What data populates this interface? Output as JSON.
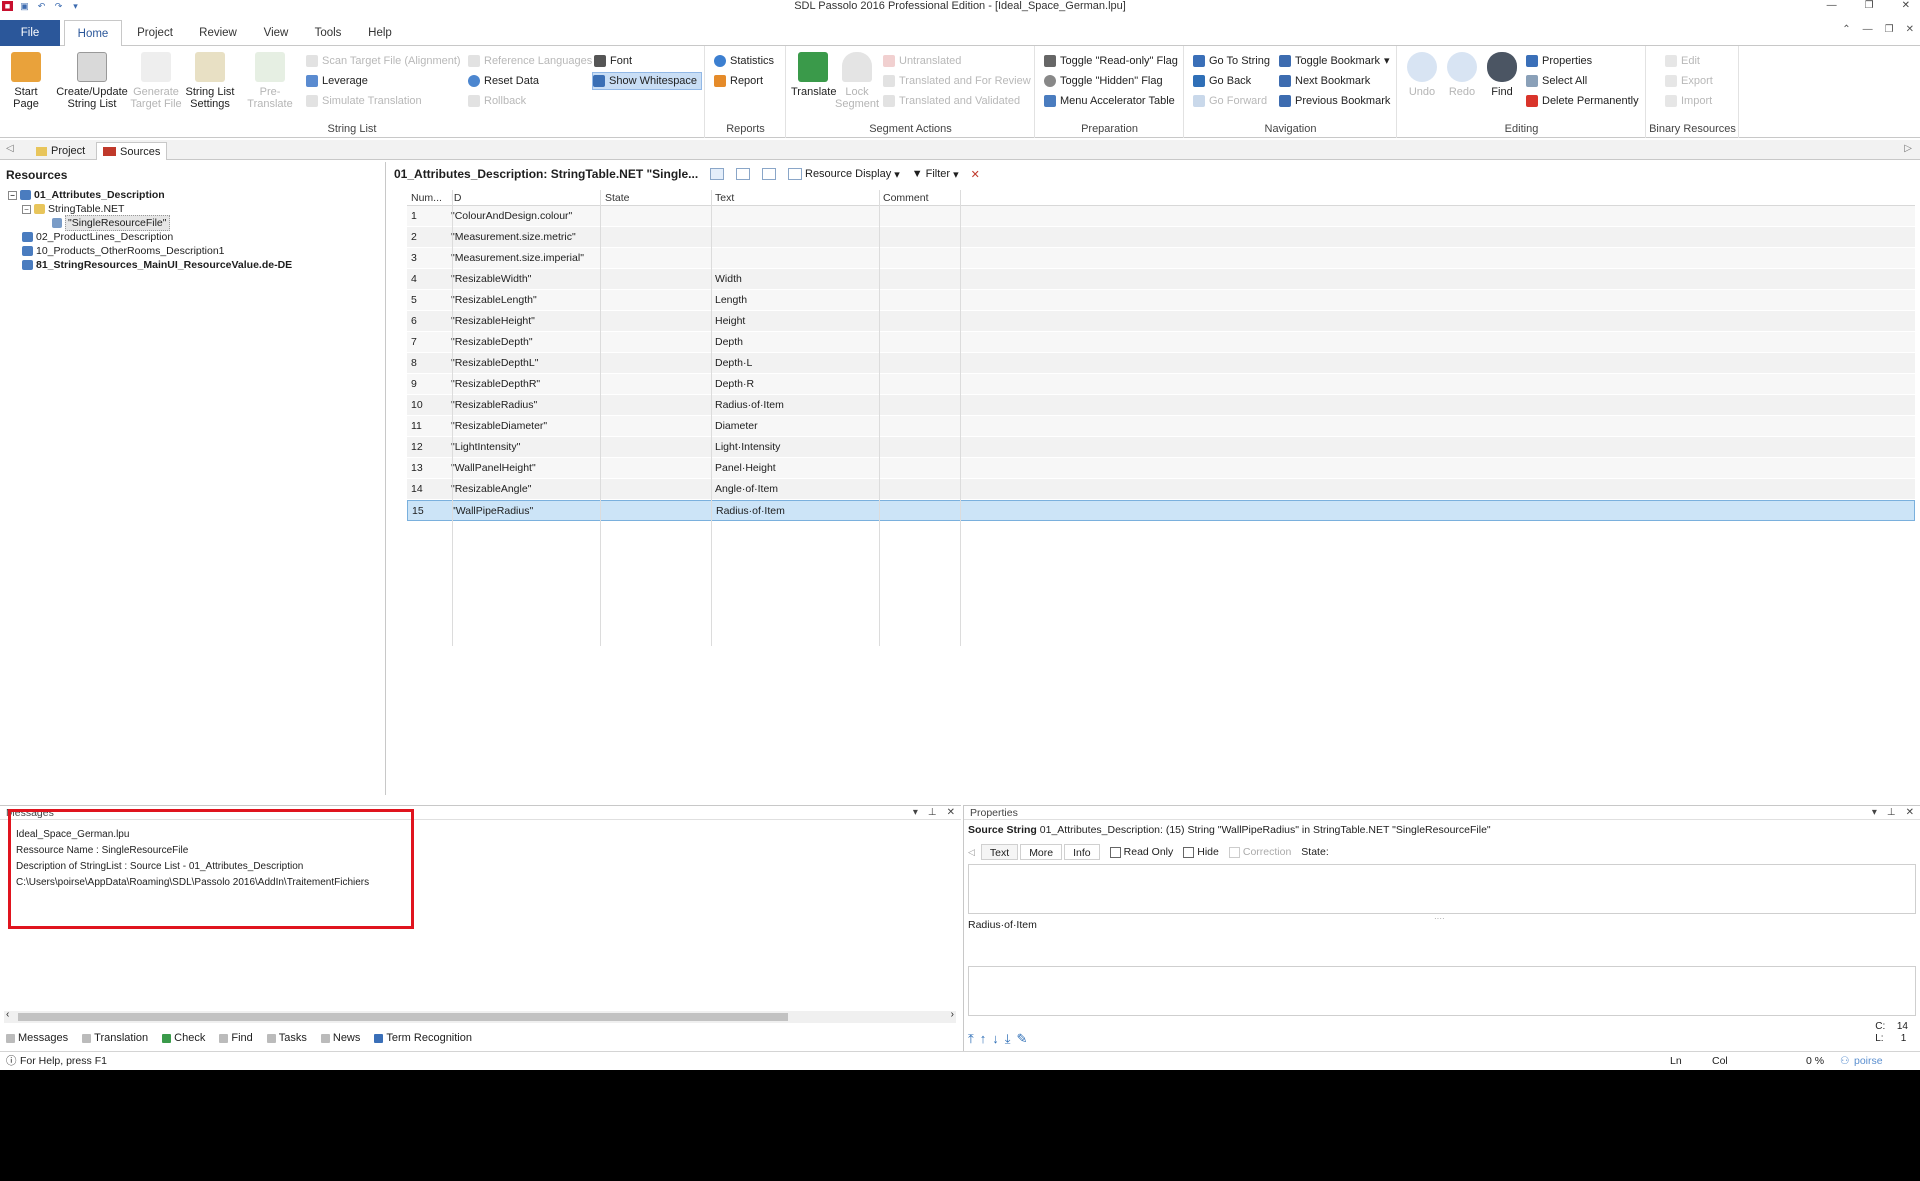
{
  "window": {
    "title": "SDL Passolo 2016 Professional Edition - [Ideal_Space_German.lpu]"
  },
  "menu": {
    "file": "File",
    "tabs": [
      "Home",
      "Project",
      "Review",
      "View",
      "Tools",
      "Help"
    ]
  },
  "ribbon": {
    "string_list": {
      "label": "String List",
      "start_page": "Start Page",
      "create_update": "Create/Update String List",
      "generate_target": "Generate Target File",
      "string_list_settings": "String List Settings",
      "pre_translate": "Pre-Translate",
      "scan_target": "Scan Target File (Alignment)",
      "leverage": "Leverage",
      "simulate": "Simulate Translation",
      "reference_languages": "Reference Languages",
      "reset_data": "Reset Data",
      "rollback": "Rollback",
      "font": "Font",
      "show_whitespace": "Show Whitespace"
    },
    "reports": {
      "label": "Reports",
      "statistics": "Statistics",
      "report": "Report"
    },
    "segment_actions": {
      "label": "Segment Actions",
      "translate": "Translate",
      "lock_segment": "Lock Segment",
      "untranslated": "Untranslated",
      "translated_review": "Translated and For Review",
      "translated_validated": "Translated and Validated"
    },
    "preparation": {
      "label": "Preparation",
      "toggle_readonly": "Toggle \"Read-only\" Flag",
      "toggle_hidden": "Toggle \"Hidden\" Flag",
      "menu_accel": "Menu Accelerator Table"
    },
    "navigation": {
      "label": "Navigation",
      "go_to_string": "Go To String",
      "go_back": "Go Back",
      "go_forward": "Go Forward",
      "toggle_bookmark": "Toggle Bookmark",
      "next_bookmark": "Next Bookmark",
      "previous_bookmark": "Previous Bookmark"
    },
    "editing": {
      "label": "Editing",
      "undo": "Undo",
      "redo": "Redo",
      "find": "Find",
      "properties": "Properties",
      "select_all": "Select All",
      "delete_permanently": "Delete Permanently"
    },
    "binary": {
      "label": "Binary Resources",
      "edit": "Edit",
      "export": "Export",
      "import": "Import"
    }
  },
  "doc_tabs": {
    "project": "Project",
    "sources": "Sources"
  },
  "resources": {
    "header": "Resources",
    "nodes": [
      "01_Attributes_Description",
      "StringTable.NET",
      "\"SingleResourceFile\"",
      "02_ProductLines_Description",
      "10_Products_OtherRooms_Description1",
      "81_StringResources_MainUI_ResourceValue.de-DE"
    ]
  },
  "grid": {
    "title": "01_Attributes_Description: StringTable.NET \"Single...",
    "resource_display": "Resource Display",
    "filter": "Filter",
    "columns": [
      "Num...",
      "ID",
      "State",
      "Text",
      "Comment"
    ],
    "rows": [
      {
        "num": "1",
        "id": "\"ColourAndDesign.colour\"",
        "text": ""
      },
      {
        "num": "2",
        "id": "\"Measurement.size.metric\"",
        "text": ""
      },
      {
        "num": "3",
        "id": "\"Measurement.size.imperial\"",
        "text": ""
      },
      {
        "num": "4",
        "id": "\"ResizableWidth\"",
        "text": "Width"
      },
      {
        "num": "5",
        "id": "\"ResizableLength\"",
        "text": "Length"
      },
      {
        "num": "6",
        "id": "\"ResizableHeight\"",
        "text": "Height"
      },
      {
        "num": "7",
        "id": "\"ResizableDepth\"",
        "text": "Depth"
      },
      {
        "num": "8",
        "id": "\"ResizableDepthL\"",
        "text": "Depth·L"
      },
      {
        "num": "9",
        "id": "\"ResizableDepthR\"",
        "text": "Depth·R"
      },
      {
        "num": "10",
        "id": "\"ResizableRadius\"",
        "text": "Radius·of·Item"
      },
      {
        "num": "11",
        "id": "\"ResizableDiameter\"",
        "text": "Diameter"
      },
      {
        "num": "12",
        "id": "\"LightIntensity\"",
        "text": "Light·Intensity"
      },
      {
        "num": "13",
        "id": "\"WallPanelHeight\"",
        "text": "Panel·Height"
      },
      {
        "num": "14",
        "id": "\"ResizableAngle\"",
        "text": "Angle·of·Item"
      },
      {
        "num": "15",
        "id": "\"WallPipeRadius\"",
        "text": "Radius·of·Item"
      }
    ]
  },
  "messages": {
    "title": "Messages",
    "lines": [
      "Ideal_Space_German.lpu",
      "Ressource Name : SingleResourceFile",
      "Description of StringList : Source List - 01_Attributes_Description",
      "C:\\Users\\poirse\\AppData\\Roaming\\SDL\\Passolo 2016\\AddIn\\TraitementFichiers"
    ]
  },
  "properties": {
    "title": "Properties",
    "source_label": "Source String",
    "source_value": "01_Attributes_Description: (15) String \"WallPipeRadius\" in StringTable.NET \"SingleResourceFile\"",
    "tabs": [
      "Text",
      "More",
      "Info"
    ],
    "read_only": "Read Only",
    "hide": "Hide",
    "correction": "Correction",
    "state": "State:",
    "text_value": "Radius·of·Item",
    "c_label": "C:",
    "c_value": "14",
    "l_label": "L:",
    "l_value": "1"
  },
  "bottom_tabs": [
    "Messages",
    "Translation",
    "Check",
    "Find",
    "Tasks",
    "News",
    "Term Recognition"
  ],
  "status": {
    "help": "For Help, press F1",
    "ln": "Ln",
    "col": "Col",
    "percent": "0 %",
    "user": "poirse"
  }
}
